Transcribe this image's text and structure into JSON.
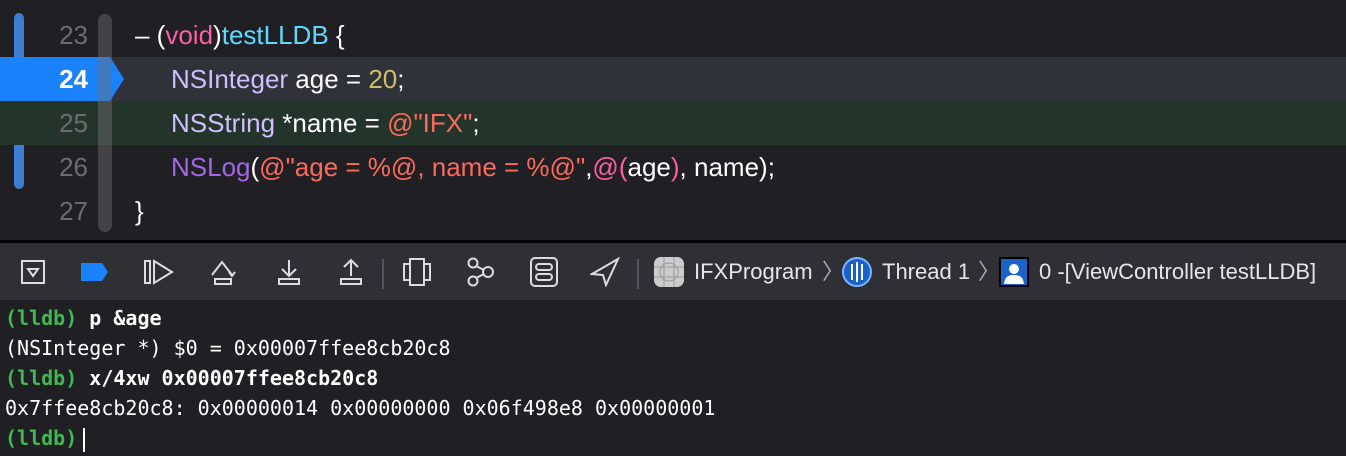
{
  "editor": {
    "lines": [
      {
        "num": "23",
        "tokens": {
          "a": "– (",
          "b": "void",
          ")": ")",
          "fn": "testLLDB",
          "e": " {"
        }
      },
      {
        "num": "24",
        "tokens": {
          "ty": "NSInteger",
          "a": " age = ",
          "num": "20",
          "e": ";"
        }
      },
      {
        "num": "25",
        "tokens": {
          "ty": "NSString",
          "a": " *name = ",
          "str": "@\"IFX\"",
          "e": ";"
        }
      },
      {
        "num": "26",
        "tokens": {
          "cls": "NSLog",
          "p": "(",
          "str": "@\"age = %@, name = %@\"",
          "c": ",",
          "at": "@(",
          "v": "age",
          ")": ")",
          "e": ", name);"
        }
      },
      {
        "num": "27",
        "tokens": {
          "a": "}"
        }
      }
    ],
    "current_line": "24"
  },
  "toolbar": {
    "buttons": [
      "hide-debug-area",
      "breakpoints-toggle",
      "continue",
      "step-over",
      "step-into",
      "step-out",
      "view-hierarchy",
      "memory-graph",
      "environment-overrides",
      "simulate-location"
    ],
    "breadcrumb": {
      "app": "IFXProgram",
      "thread": "Thread 1",
      "frame": "0 -[ViewController testLLDB]"
    }
  },
  "console": {
    "lines": [
      {
        "prompt": "(lldb)",
        "cmd": " p &age"
      },
      {
        "out": "(NSInteger *) $0 = 0x00007ffee8cb20c8"
      },
      {
        "prompt": "(lldb)",
        "cmd": " x/4xw 0x00007ffee8cb20c8"
      },
      {
        "out": "0x7ffee8cb20c8: 0x00000014 0x00000000 0x06f498e8 0x00000001"
      },
      {
        "prompt": "(lldb)"
      }
    ]
  },
  "colors": {
    "accent": "#1a82fb",
    "prompt": "#3fb950",
    "keyword": "#fc5fa3",
    "string": "#fc6a5d",
    "number": "#d0bf69",
    "type": "#d0bfff"
  }
}
